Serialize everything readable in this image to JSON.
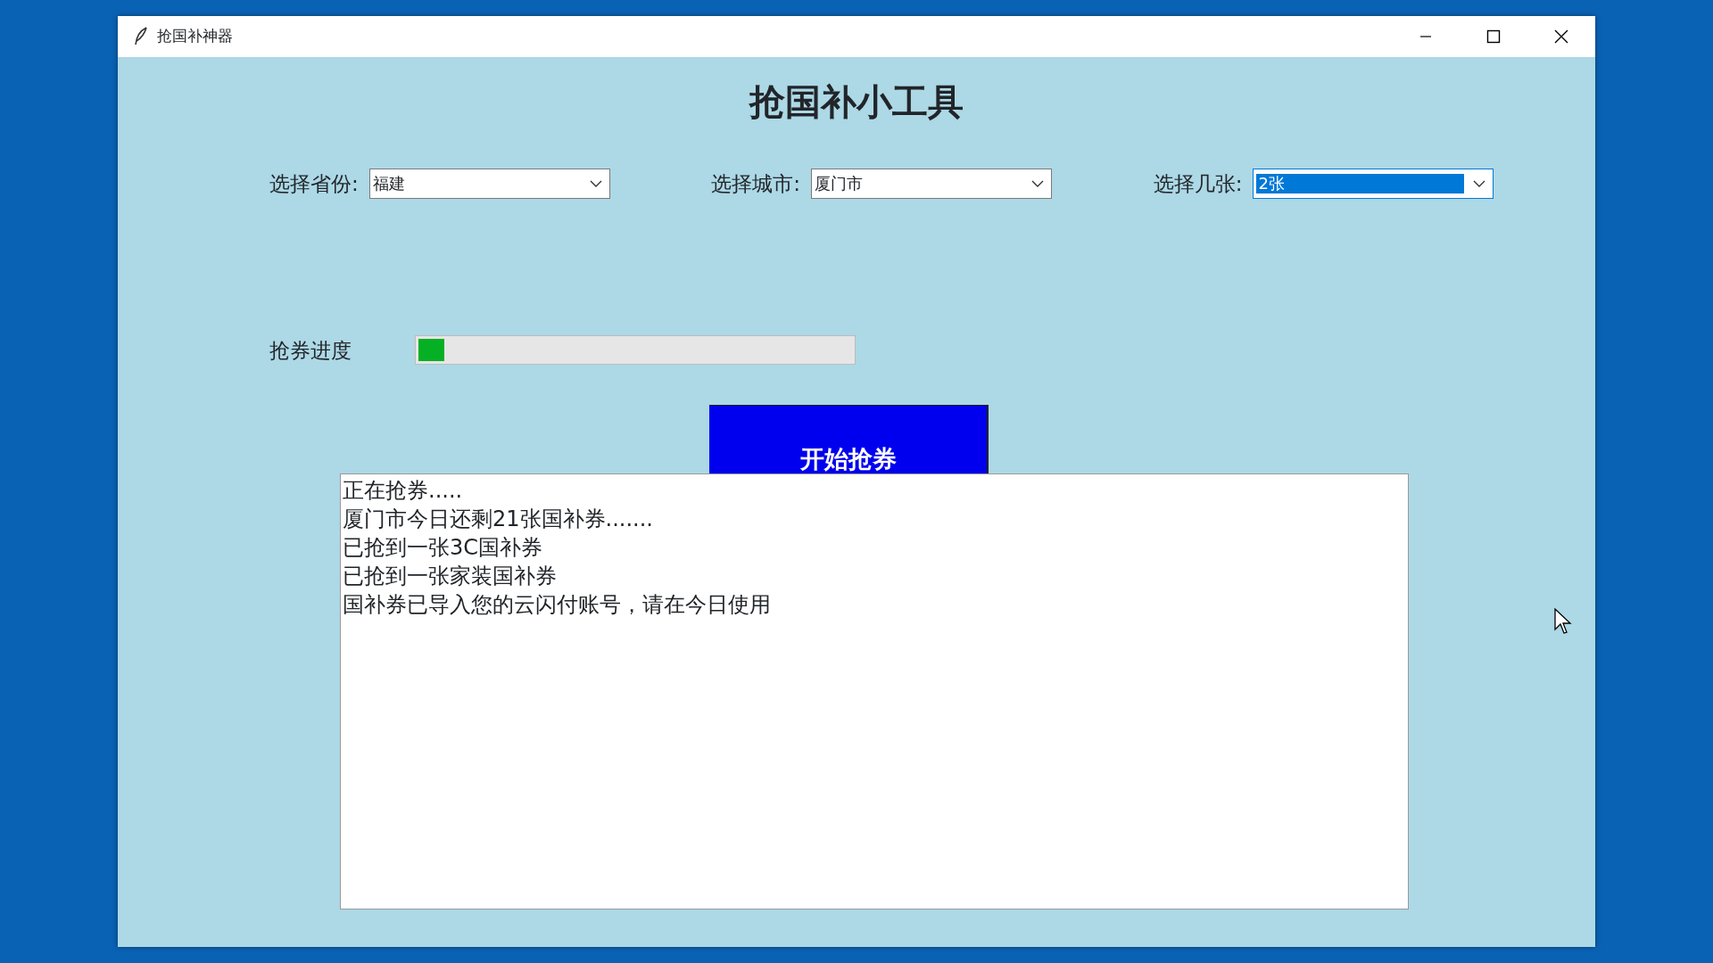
{
  "window": {
    "title": "抢国补神器"
  },
  "heading": "抢国补小工具",
  "selectors": [
    {
      "label": "选择省份:",
      "value": "福建",
      "focused": false
    },
    {
      "label": "选择城市:",
      "value": "厦门市",
      "focused": false
    },
    {
      "label": "选择几张:",
      "value": "2张",
      "focused": true
    }
  ],
  "progress": {
    "label": "抢券进度",
    "level": 0.06
  },
  "start_button": "开始抢券",
  "log_lines": [
    "正在抢券.....",
    "厦门市今日还剩21张国补券.......",
    "已抢到一张3C国补券",
    "已抢到一张家装国补券",
    "国补券已导入您的云闪付账号，请在今日使用"
  ]
}
